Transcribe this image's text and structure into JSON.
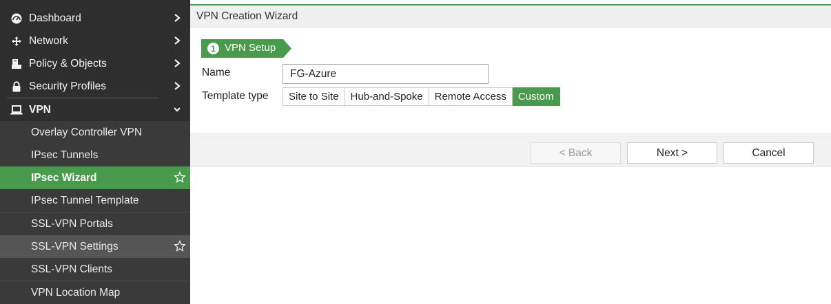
{
  "sidebar": {
    "items": [
      {
        "label": "Dashboard",
        "icon": "dashboard-icon"
      },
      {
        "label": "Network",
        "icon": "network-icon"
      },
      {
        "label": "Policy & Objects",
        "icon": "policy-icon"
      },
      {
        "label": "Security Profiles",
        "icon": "lock-icon"
      },
      {
        "label": "VPN",
        "icon": "laptop-icon"
      }
    ],
    "vpn_subitems": [
      {
        "label": "Overlay Controller VPN"
      },
      {
        "label": "IPsec Tunnels"
      },
      {
        "label": "IPsec Wizard",
        "active": true
      },
      {
        "label": "IPsec Tunnel Template"
      },
      {
        "label": "SSL-VPN Portals"
      },
      {
        "label": "SSL-VPN Settings"
      },
      {
        "label": "SSL-VPN Clients"
      },
      {
        "label": "VPN Location Map"
      }
    ]
  },
  "header": {
    "title": "VPN Creation Wizard"
  },
  "wizard": {
    "step_number": "1",
    "step_label": "VPN Setup",
    "name_label": "Name",
    "name_value": "FG-Azure",
    "template_label": "Template type",
    "template_options": [
      "Site to Site",
      "Hub-and-Spoke",
      "Remote Access",
      "Custom"
    ],
    "template_selected": "Custom"
  },
  "buttons": {
    "back": "< Back",
    "next": "Next >",
    "cancel": "Cancel"
  },
  "colors": {
    "accent": "#4a9a4e",
    "sidebar_bg": "#2e2e2e"
  }
}
